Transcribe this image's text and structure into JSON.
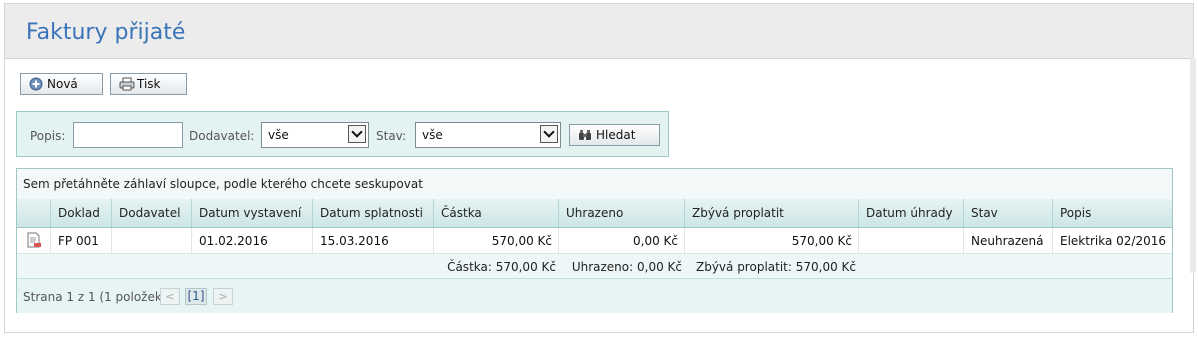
{
  "page": {
    "title": "Faktury přijaté"
  },
  "toolbar": {
    "new_label": "Nová",
    "print_label": "Tisk"
  },
  "filters": {
    "popis_label": "Popis:",
    "popis_value": "",
    "dodavatel_label": "Dodavatel:",
    "dodavatel_value": "vše",
    "stav_label": "Stav:",
    "stav_value": "vše",
    "search_label": "Hledat"
  },
  "grid": {
    "group_hint": "Sem přetáhněte záhlaví sloupce, podle kterého chcete seskupovat",
    "columns": [
      "Doklad",
      "Dodavatel",
      "Datum vystavení",
      "Datum splatnosti",
      "Částka",
      "Uhrazeno",
      "Zbývá proplatit",
      "Datum úhrady",
      "Stav",
      "Popis"
    ],
    "rows": [
      {
        "doklad": "FP 001",
        "dodavatel": "",
        "datum_vystaveni": "01.02.2016",
        "datum_splatnosti": "15.03.2016",
        "castka": "570,00 Kč",
        "uhrazeno": "0,00 Kč",
        "zbyva": "570,00 Kč",
        "datum_uhrady": "",
        "stav": "Neuhrazená",
        "popis": "Elektrika 02/2016"
      }
    ],
    "totals": {
      "castka": "Částka: 570,00 Kč",
      "uhrazeno": "Uhrazeno: 0,00 Kč",
      "zbyva": "Zbývá proplatit: 570,00 Kč"
    },
    "pager": {
      "summary": "Strana 1 z 1 (1 položek)",
      "prev": "<",
      "current": "[1]",
      "next": ">"
    }
  },
  "colors": {
    "title": "#3b73b9",
    "link": "#2d6aa8",
    "accent_border": "#9fc9c8"
  }
}
